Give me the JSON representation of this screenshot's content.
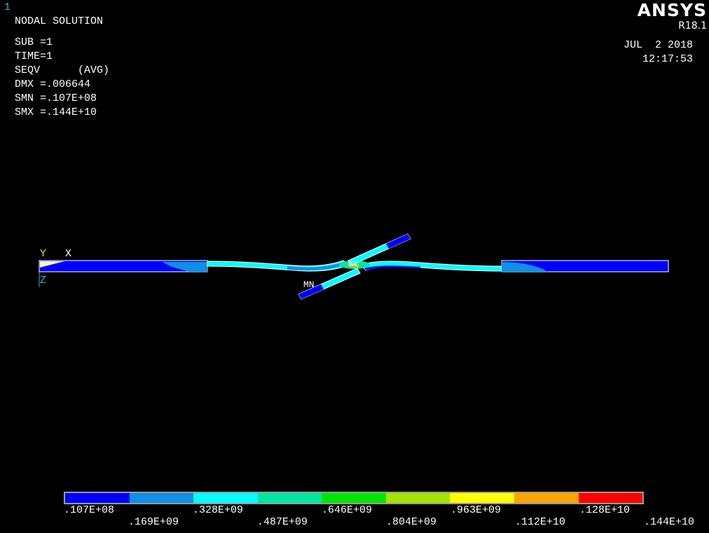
{
  "window_number": "1",
  "info": {
    "title": "NODAL SOLUTION",
    "sub": "SUB =1",
    "time": "TIME=1",
    "item": "SEQV      (AVG)",
    "dmx": "DMX =.006644",
    "smn": "SMN =.107E+08",
    "smx": "SMX =.144E+10"
  },
  "logo": {
    "name": "ANSYS",
    "release": "R18.1"
  },
  "datetime": {
    "date": "JUL  2 2018",
    "time": "12:17:53"
  },
  "triad": {
    "y": "Y",
    "x": "X",
    "z": "Z"
  },
  "markers": {
    "mn": "MN",
    "mx": "MX"
  },
  "legend": {
    "colors": [
      "#0000ff",
      "#0f8fe6",
      "#00ffff",
      "#00e6a0",
      "#00e600",
      "#a0e600",
      "#ffff00",
      "#ffa500",
      "#ff0000"
    ],
    "labels_top": [
      ".107E+08",
      ".328E+09",
      ".646E+09",
      ".963E+09",
      ".128E+10"
    ],
    "labels_bottom": [
      ".169E+09",
      ".487E+09",
      ".804E+09",
      ".112E+10",
      ".144E+10"
    ]
  }
}
